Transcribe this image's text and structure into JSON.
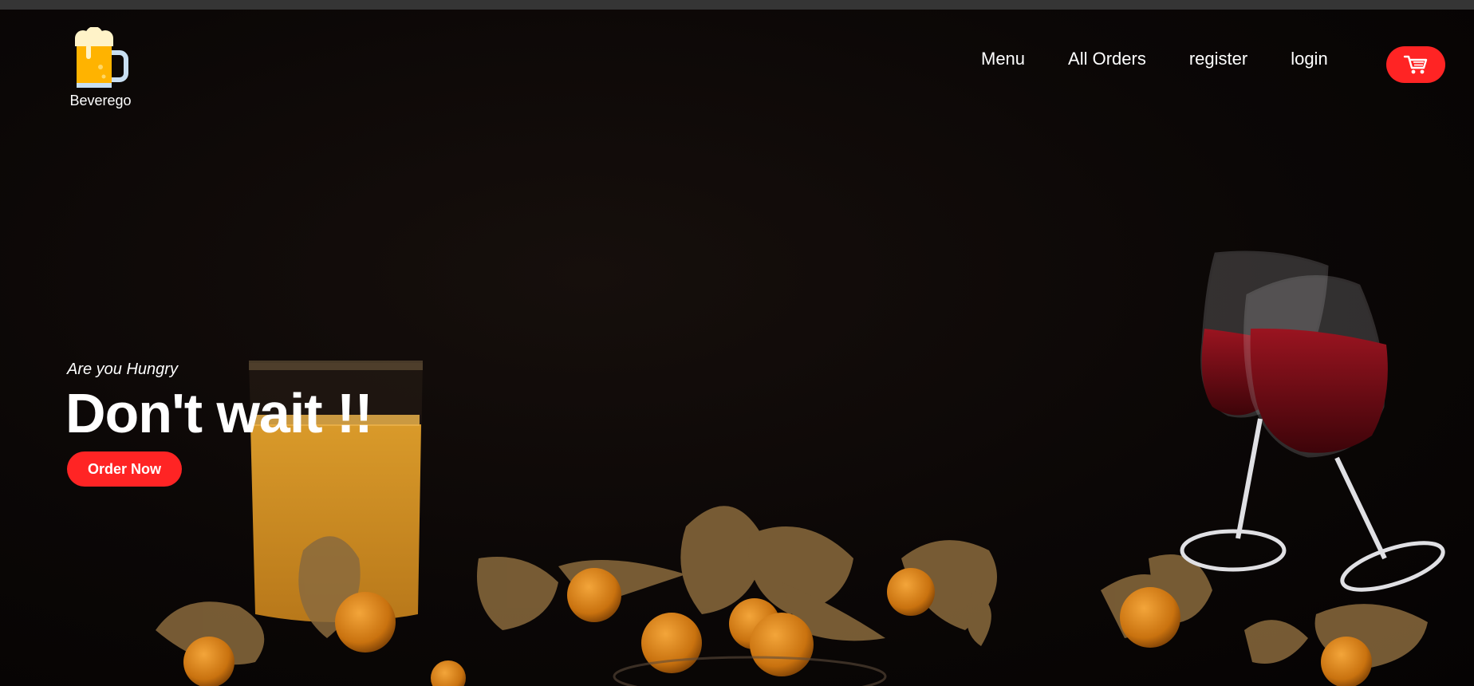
{
  "brand": {
    "name": "Beverego",
    "logo_icon": "beer-mug-icon"
  },
  "nav": {
    "items": [
      {
        "label": "Menu"
      },
      {
        "label": "All Orders"
      },
      {
        "label": "register"
      },
      {
        "label": "login"
      }
    ],
    "cart_icon": "shopping-cart-icon"
  },
  "hero": {
    "subtitle": "Are you Hungry",
    "title": "Don't wait !!",
    "cta_label": "Order Now"
  },
  "colors": {
    "accent": "#ff2424",
    "background": "#0b0706",
    "text": "#ffffff"
  }
}
